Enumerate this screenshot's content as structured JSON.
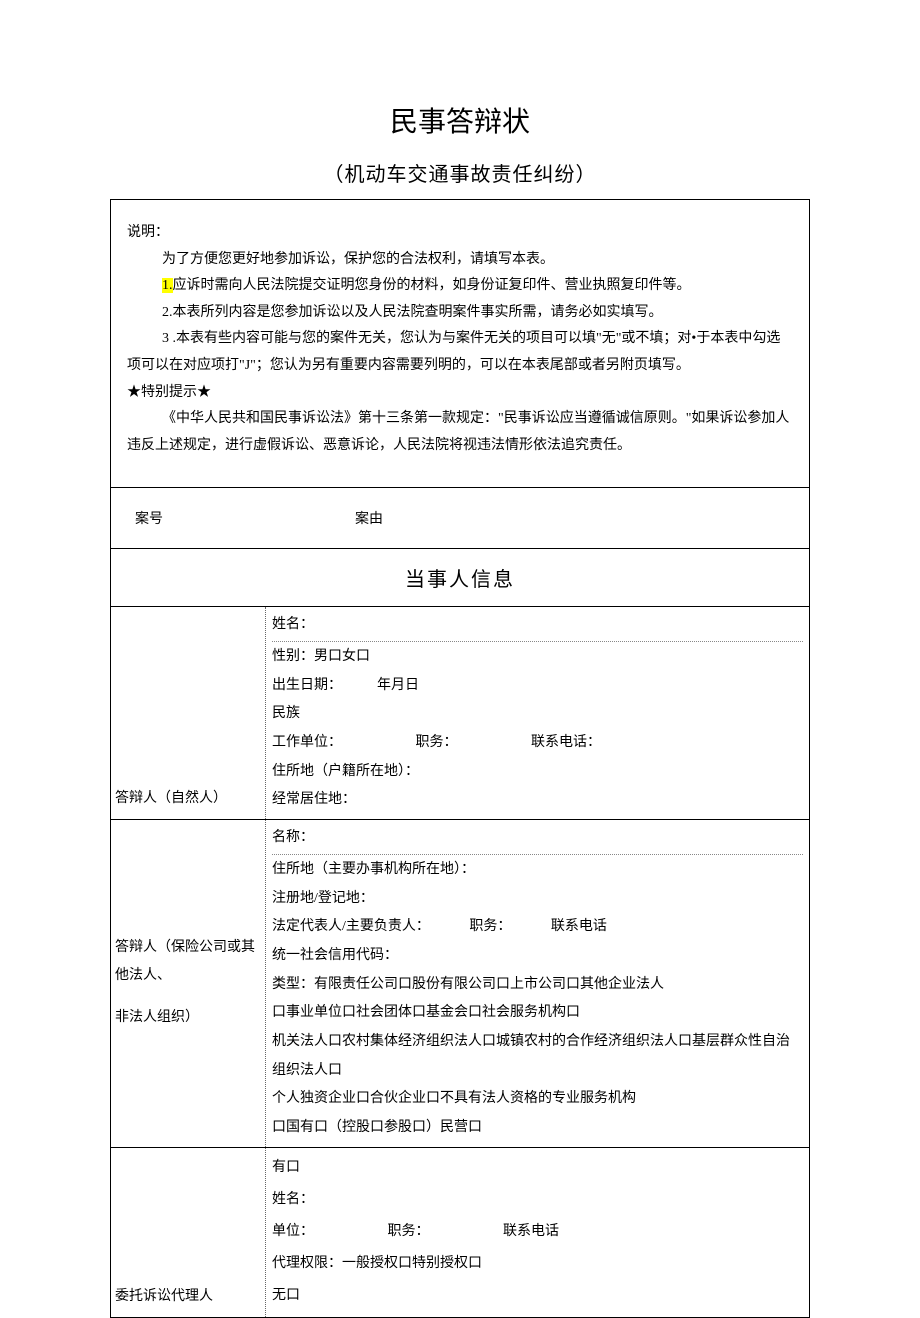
{
  "title": "民事答辩状",
  "subtitle": "（机动车交通事故责任纠纷）",
  "desc": {
    "label": "说明：",
    "line1": "为了方便您更好地参加诉讼，保护您的合法权利，请填写本表。",
    "line2a": "1.",
    "line2b": "应诉时需向人民法院提交证明您身份的材料，如身份证复印件、营业执照复印件等。",
    "line3": "2.本表所列内容是您参加诉讼以及人民法院查明案件事实所需，请务必如实填写。",
    "line4": "3 .本表有些内容可能与您的案件无关，您认为与案件无关的项目可以填\"无\"或不填；对•于本表中勾选项可以在对应项打\"J\"；您认为另有重要内容需要列明的，可以在本表尾部或者另附页填写。",
    "tip": "★特别提示★",
    "line5": "《中华人民共和国民事诉讼法》第十三条第一款规定：\"民事诉讼应当遵循诚信原则。\"如果诉讼参加人违反上述规定，进行虚假诉讼、恶意诉论，人民法院将视违法情形依法追究责任。"
  },
  "caseRow": {
    "no": "案号",
    "reason": "案由"
  },
  "partyHeader": "当事人信息",
  "natural": {
    "label": "答辩人（自然人）",
    "name": "姓名：",
    "gender": "性别：男口女口",
    "dob": "出生日期：　　　年月日",
    "ethnic": "民族",
    "work": "工作单位：",
    "post": "职务：",
    "tel": "联系电话：",
    "domicile": "住所地（户籍所在地）：",
    "habitual": "经常居住地："
  },
  "org": {
    "label1": "答辩人（保险公司或其他法人、",
    "label2": "非法人组织）",
    "name": "名称：",
    "domicile": "住所地（主要办事机构所在地）：",
    "reg": "注册地/登记地：",
    "legal": "法定代表人/主要负责人：",
    "post": "职务：",
    "tel": "联系电话",
    "uscc": "统一社会信用代码：",
    "type1": "类型：有限责任公司口股份有限公司口上市公司口其他企业法人",
    "type2": "口事业单位口社会团体口基金会口社会服务机构口",
    "type3": "机关法人口农村集体经济组织法人口城镇农村的合作经济组织法人口基层群众性自治组织法人口",
    "type4": "个人独资企业口合伙企业口不具有法人资格的专业服务机构",
    "type5": "口国有口（控股口参股口）民营口"
  },
  "agent": {
    "label": "委托诉讼代理人",
    "has": "有口",
    "name": "姓名：",
    "unit": "单位：",
    "post": "职务：",
    "tel": "联系电话",
    "auth": "代理权限：一般授权口特别授权口",
    "none": "无口"
  }
}
